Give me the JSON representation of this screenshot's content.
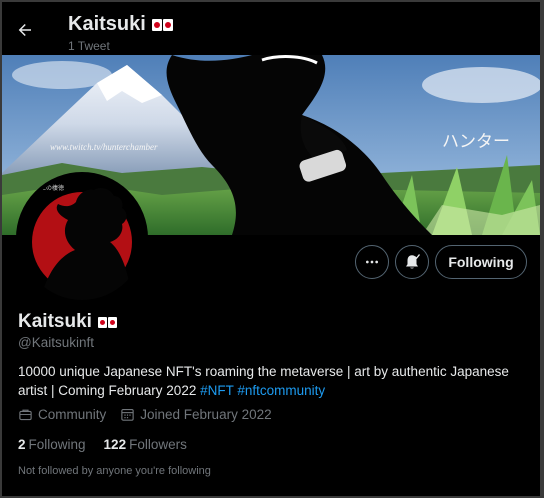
{
  "header": {
    "title": "Kaitsuki",
    "tweet_count": "1 Tweet"
  },
  "banner": {
    "url_text": "www.twitch.tv/hunterchamber",
    "kana_text": "ハンター"
  },
  "avatar": {
    "corner_text": "二の棲徳"
  },
  "actions": {
    "following_label": "Following"
  },
  "profile": {
    "name": "Kaitsuki",
    "handle": "@Kaitsukinft",
    "bio_line1": "10000 unique Japanese NFT's roaming the metaverse | art by authentic Japanese",
    "bio_line2": "artist | Coming February 2022 ",
    "hashtag1": "#NFT",
    "hashtag2": "#nftcommunity",
    "category": "Community",
    "joined": "Joined February 2022"
  },
  "stats": {
    "following_count": "2",
    "following_label": "Following",
    "followers_count": "122",
    "followers_label": "Followers"
  },
  "note": "Not followed by anyone you're following",
  "colors": {
    "accent": "#1d9bf0",
    "muted": "#71767b",
    "avatar_red": "#b30f14"
  }
}
